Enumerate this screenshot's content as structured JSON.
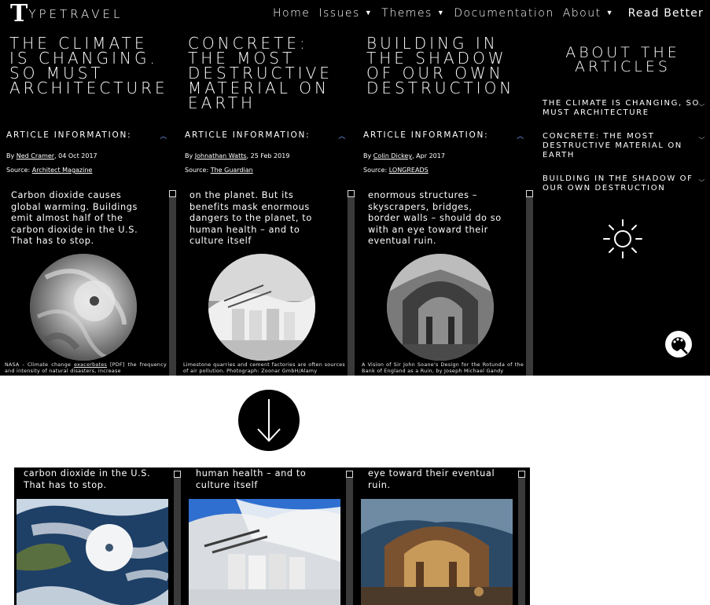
{
  "navbar": {
    "logo_mark": "T",
    "logo_text": "YPETRAVEL",
    "items": [
      {
        "label": "Home",
        "has_caret": false
      },
      {
        "label": "Issues",
        "has_caret": true
      },
      {
        "label": "Themes",
        "has_caret": true
      },
      {
        "label": "Documentation",
        "has_caret": false
      },
      {
        "label": "About",
        "has_caret": true
      }
    ],
    "read_better": "Read Better"
  },
  "articles": [
    {
      "title": "The climate is changing. So must architecture",
      "info_heading": "Article information:",
      "byline_prefix": "By ",
      "author": "Ned Cramer",
      "date": ", 04 Oct 2017",
      "source_prefix": "Source: ",
      "source": "Architect Magazine",
      "body": "Carbon dioxide causes global warming. Buildings emit almost half of the carbon dioxide in the U.S. That has to stop.",
      "caption_pre": "NASA - Climate change ",
      "caption_link": "exacerbates",
      "caption_post": " [PDF] the frequency and intensity of natural disasters, increase"
    },
    {
      "title": "Concrete: the most destructive material on Earth",
      "info_heading": "Article information:",
      "byline_prefix": "By ",
      "author": "Johnathan Watts",
      "date": ", 25 Feb 2019",
      "source_prefix": "Source: ",
      "source": "The Guardian",
      "body": "on the planet. But its benefits mask enormous dangers to the planet, to human health – and to culture itself",
      "caption": "Limestone quarries and cement factories are often sources of air pollution. Photograph: Zoonar GmbH/Alamy"
    },
    {
      "title": "Building in the shadow of our own destruction",
      "info_heading": "Article information:",
      "byline_prefix": "By ",
      "author": "Colin Dickey",
      "date": ", Apr 2017",
      "source_prefix": "Source: ",
      "source": "LONGREADS",
      "body": "enormous structures – skyscrapers, bridges, border walls – should do so with an eye toward their eventual ruin.",
      "caption": "A Vision of Sir John Soane's Design for the Rotunda of the Bank of England as a Ruin, by Joseph Michael Gandy"
    }
  ],
  "sidebar": {
    "title": "About the articles",
    "items": [
      "The climate is changing, so must architecture",
      "Concrete: the most destructive material on earth",
      "Building in the shadow of our own destruction"
    ]
  },
  "strip": {
    "columns": [
      {
        "text": "carbon dioxide in the U.S. That has to stop."
      },
      {
        "text": "human health – and to culture itself"
      },
      {
        "text": "eye toward their eventual ruin."
      }
    ]
  },
  "icons": {
    "sun": "sun-icon",
    "palette": "palette-icon",
    "arrow": "arrow-down-icon",
    "chevron_up": "chevron-up-icon",
    "chevron_down": "chevron-down-icon"
  },
  "colors": {
    "background": "#000000",
    "text": "#ffffff",
    "accent_chevron": "#7aa6ff",
    "scrollbar_track": "#3a3a3a"
  }
}
